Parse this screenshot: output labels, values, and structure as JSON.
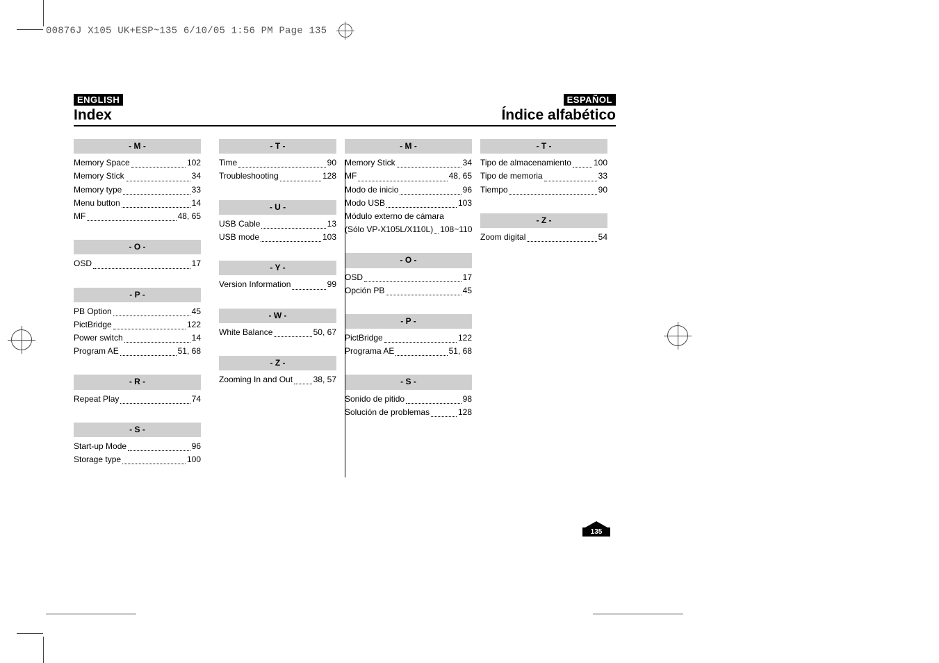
{
  "header_line": "00876J X105 UK+ESP~135  6/10/05 1:56 PM  Page 135",
  "lang_left": "ENGLISH",
  "lang_right": "ESPAÑOL",
  "title_left": "Index",
  "title_right": "Índice alfabético",
  "page_number": "135",
  "columns": [
    {
      "groups": [
        {
          "header": "- M -",
          "entries": [
            {
              "label": "Memory Space",
              "page": "102"
            },
            {
              "label": "Memory Stick",
              "page": "34"
            },
            {
              "label": "Memory type",
              "page": "33"
            },
            {
              "label": "Menu button",
              "page": "14"
            },
            {
              "label": "MF",
              "page": "48, 65"
            }
          ]
        },
        {
          "header": "- O -",
          "entries": [
            {
              "label": "OSD",
              "page": "17"
            }
          ]
        },
        {
          "header": "- P -",
          "entries": [
            {
              "label": "PB Option",
              "page": "45"
            },
            {
              "label": "PictBridge",
              "page": "122"
            },
            {
              "label": "Power switch",
              "page": "14"
            },
            {
              "label": "Program AE",
              "page": "51, 68"
            }
          ]
        },
        {
          "header": "- R -",
          "entries": [
            {
              "label": "Repeat Play",
              "page": "74"
            }
          ]
        },
        {
          "header": "- S -",
          "entries": [
            {
              "label": "Start-up Mode",
              "page": "96"
            },
            {
              "label": "Storage type",
              "page": "100"
            }
          ]
        }
      ]
    },
    {
      "groups": [
        {
          "header": "- T -",
          "entries": [
            {
              "label": "Time",
              "page": "90"
            },
            {
              "label": "Troubleshooting",
              "page": "128"
            }
          ]
        },
        {
          "header": "- U -",
          "entries": [
            {
              "label": "USB Cable",
              "page": "13"
            },
            {
              "label": "USB mode",
              "page": "103"
            }
          ]
        },
        {
          "header": "- Y -",
          "entries": [
            {
              "label": "Version Information",
              "page": "99"
            }
          ]
        },
        {
          "header": "- W -",
          "entries": [
            {
              "label": "White Balance",
              "page": "50, 67"
            }
          ]
        },
        {
          "header": "- Z -",
          "entries": [
            {
              "label": "Zooming In and Out",
              "page": "38, 57"
            }
          ]
        }
      ]
    },
    {
      "groups": [
        {
          "header": "- M -",
          "entries": [
            {
              "label": "Memory Stick",
              "page": "34"
            },
            {
              "label": "MF",
              "page": "48, 65"
            },
            {
              "label": "Modo de inicio",
              "page": "96"
            },
            {
              "label": "Modo USB",
              "page": "103"
            },
            {
              "label": "Módulo externo de cámara",
              "page": ""
            },
            {
              "label": "(Sólo VP-X105L/X110L)",
              "page": "108~110"
            }
          ]
        },
        {
          "header": "- O -",
          "entries": [
            {
              "label": "OSD",
              "page": "17"
            },
            {
              "label": "Opción PB",
              "page": "45"
            }
          ]
        },
        {
          "header": "- P -",
          "entries": [
            {
              "label": "PictBridge",
              "page": "122"
            },
            {
              "label": "Programa AE",
              "page": "51, 68"
            }
          ]
        },
        {
          "header": "- S -",
          "entries": [
            {
              "label": "Sonido de pitido",
              "page": "98"
            },
            {
              "label": "Solución de problemas",
              "page": "128"
            }
          ]
        }
      ]
    },
    {
      "groups": [
        {
          "header": "- T -",
          "entries": [
            {
              "label": "Tipo de almacenamiento",
              "page": "100"
            },
            {
              "label": "Tipo de memoria",
              "page": "33"
            },
            {
              "label": "Tiempo",
              "page": "90"
            }
          ]
        },
        {
          "header": "- Z -",
          "entries": [
            {
              "label": "Zoom digital",
              "page": "54"
            }
          ]
        }
      ]
    }
  ]
}
